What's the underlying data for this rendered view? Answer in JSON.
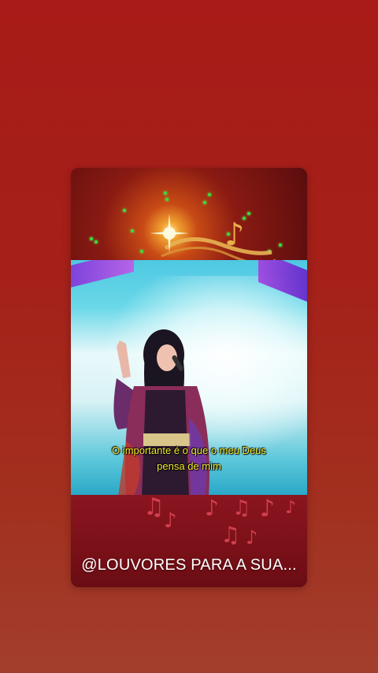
{
  "story": {
    "subtitle_line1": "O importante é o que o meu Deus",
    "subtitle_line2": "pensa de mim",
    "channel_handle": "@LOUVORES PARA A SUA..."
  },
  "colors": {
    "background": "#a81b18",
    "subtitle": "#f4ea2e",
    "handle_text": "#ffffff"
  },
  "icons": [
    "sparkle-flare-icon",
    "gold-music-note-icon",
    "music-note-icon"
  ]
}
